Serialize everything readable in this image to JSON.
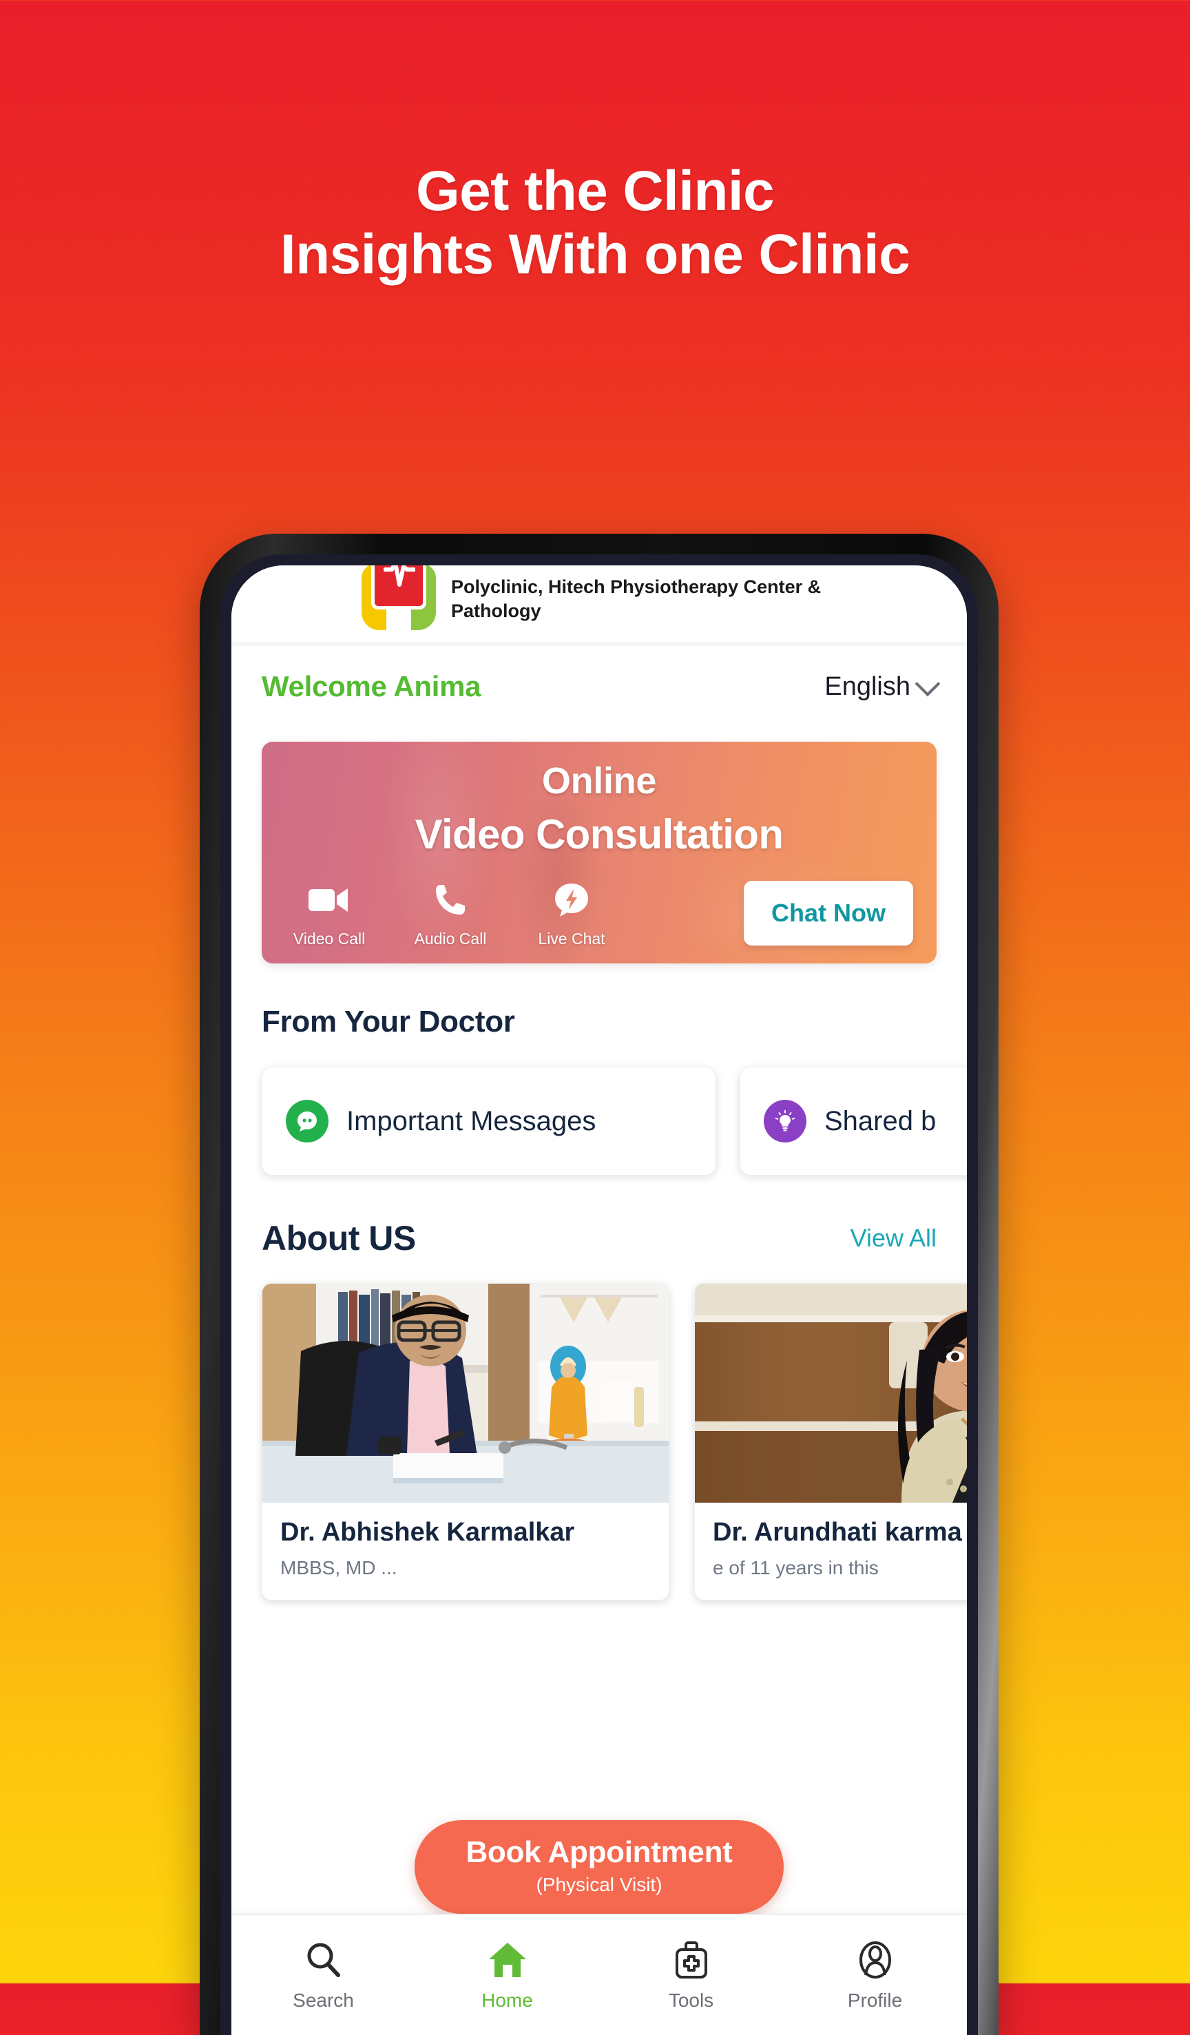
{
  "promo": {
    "headline_line1": "Get the Clinic",
    "headline_line2": "Insights With one Clinic",
    "bg_top_color": "#e9202b",
    "bg_mid_color": "#f57f18",
    "bg_bottom_color": "#fed50b",
    "text_color": "#ffffff"
  },
  "app": {
    "header": {
      "logo_name": "polyclinic-logo",
      "clinic_name": "Polyclinic, Hitech Physiotherapy Center & Pathology"
    },
    "welcome": {
      "greeting": "Welcome Anima",
      "greeting_color": "#55bb33",
      "language": "English",
      "chevron_icon": "chevron-down-icon"
    },
    "banner": {
      "title_line1": "Online",
      "title_line2": "Video Consultation",
      "modes": [
        {
          "label": "Video Call",
          "icon": "video-camera-icon"
        },
        {
          "label": "Audio Call",
          "icon": "phone-icon"
        },
        {
          "label": "Live Chat",
          "icon": "chat-bolt-icon"
        }
      ],
      "cta_label": "Chat Now",
      "cta_text_color": "#0f97a2",
      "gradient_from": "#ce6e86",
      "gradient_to": "#f59b5c"
    },
    "from_doctor": {
      "title": "From Your Doctor",
      "cards": [
        {
          "label": "Important Messages",
          "icon": "chat-bubble-icon",
          "icon_color": "#22b14c"
        },
        {
          "label": "Shared b",
          "icon": "lightbulb-icon",
          "icon_color": "#8b3fc4"
        }
      ]
    },
    "about": {
      "title": "About US",
      "view_all": "View All",
      "view_all_color": "#19a7b5",
      "doctors": [
        {
          "name": "Dr. Abhishek Karmalkar",
          "subtitle": "MBBS, MD ...",
          "photo_name": "doctor-photo-abhishek"
        },
        {
          "name": "Dr. Arundhati karma",
          "subtitle": "e of 11 years in this",
          "photo_name": "doctor-photo-arundhati"
        }
      ]
    },
    "book_appointment": {
      "label": "Book Appointment",
      "sublabel": "(Physical Visit)",
      "color": "#f4694f"
    },
    "bottom_nav": {
      "items": [
        {
          "label": "Search",
          "icon": "search-icon",
          "active": false
        },
        {
          "label": "Home",
          "icon": "home-icon",
          "active": true
        },
        {
          "label": "Tools",
          "icon": "medkit-icon",
          "active": false
        },
        {
          "label": "Profile",
          "icon": "person-icon",
          "active": false
        }
      ],
      "active_color": "#62bb36"
    }
  }
}
